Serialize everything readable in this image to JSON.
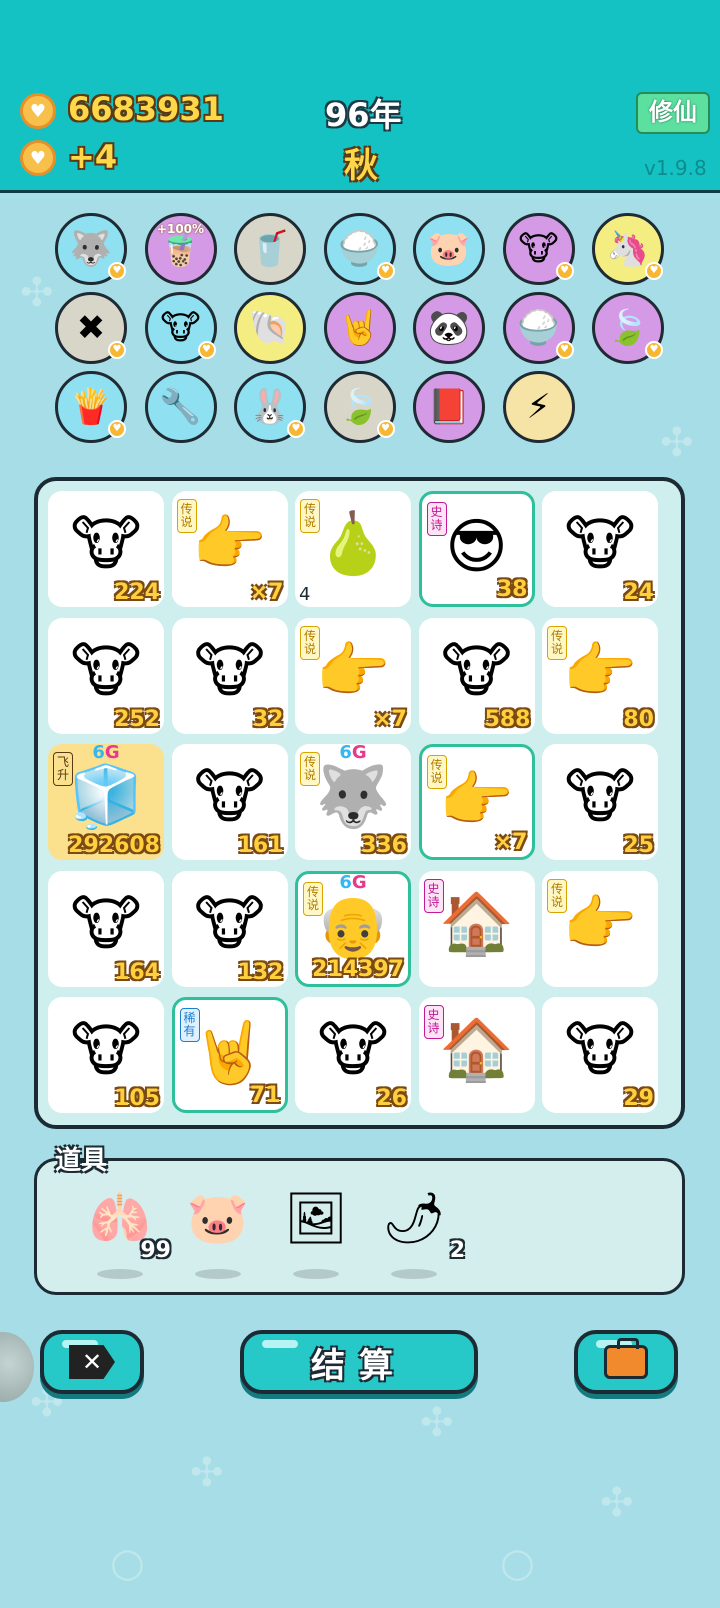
{
  "header": {
    "coins": "6683931",
    "income": "+4",
    "year": "96年",
    "season": "秋",
    "xiuxian_label": "修仙",
    "version": "v1.9.8"
  },
  "owned_icons": [
    {
      "name": "husky",
      "icon": "🐺",
      "bg": "#8fe0f0",
      "heart": true
    },
    {
      "name": "milk-tea-bonus",
      "icon": "🧋",
      "bg": "#d49ae6",
      "heart": false,
      "label": "+100%"
    },
    {
      "name": "bubble-tea",
      "icon": "🥤",
      "bg": "#d8d6c8",
      "heart": false
    },
    {
      "name": "rice-bowl",
      "icon": "🍚",
      "bg": "#8fe0f0",
      "heart": true
    },
    {
      "name": "piggy-bank",
      "icon": "🐷",
      "bg": "#8fe0f0",
      "heart": false
    },
    {
      "name": "cows-pair",
      "icon": "🐮",
      "bg": "#d49ae6",
      "heart": true
    },
    {
      "name": "unicorn",
      "icon": "🦄",
      "bg": "#f4ee82",
      "heart": true
    },
    {
      "name": "delete-tag",
      "icon": "✖",
      "bg": "#d8d6c8",
      "heart": true
    },
    {
      "name": "cows-pair-2",
      "icon": "🐮",
      "bg": "#8fe0f0",
      "heart": true
    },
    {
      "name": "shell",
      "icon": "🐚",
      "bg": "#f4ee82",
      "heart": false
    },
    {
      "name": "rock-hand",
      "icon": "🤘",
      "bg": "#d49ae6",
      "heart": false
    },
    {
      "name": "panda",
      "icon": "🐼",
      "bg": "#d49ae6",
      "heart": false
    },
    {
      "name": "rice-bowl-2",
      "icon": "🍚",
      "bg": "#d49ae6",
      "heart": true
    },
    {
      "name": "leaf",
      "icon": "🍃",
      "bg": "#d49ae6",
      "heart": true
    },
    {
      "name": "fries",
      "icon": "🍟",
      "bg": "#8fe0f0",
      "heart": true
    },
    {
      "name": "pump",
      "icon": "🔧",
      "bg": "#8fe0f0",
      "heart": false
    },
    {
      "name": "rabbit",
      "icon": "🐰",
      "bg": "#8fe0f0",
      "heart": true
    },
    {
      "name": "leaf-2",
      "icon": "🍃",
      "bg": "#d8d6c8",
      "heart": true
    },
    {
      "name": "time-magazine",
      "icon": "📕",
      "bg": "#d49ae6",
      "heart": false
    },
    {
      "name": "lightning",
      "icon": "⚡",
      "bg": "#f6e3a6",
      "heart": false
    }
  ],
  "board": [
    {
      "icon": "🐮",
      "count": "224"
    },
    {
      "icon": "👉",
      "count": "×7",
      "tag": "传说",
      "tag_type": "legend"
    },
    {
      "icon": "🍐",
      "count_left": "4",
      "tag": "传说",
      "tag_type": "legend"
    },
    {
      "icon": "😎",
      "count": "38",
      "tag": "史诗",
      "tag_type": "epic",
      "selected": true
    },
    {
      "icon": "🐮",
      "count": "24"
    },
    {
      "icon": "🐮",
      "count": "252"
    },
    {
      "icon": "🐮",
      "count": "32"
    },
    {
      "icon": "👉",
      "count": "×7",
      "tag": "传说",
      "tag_type": "legend"
    },
    {
      "icon": "🐮",
      "count": "588"
    },
    {
      "icon": "👉",
      "count": "80",
      "tag": "传说",
      "tag_type": "legend"
    },
    {
      "icon": "🧊",
      "count": "292608",
      "tag": "飞升",
      "tag_type": "fly",
      "gold": true,
      "sixg": true
    },
    {
      "icon": "🐮",
      "count": "161"
    },
    {
      "icon": "🐺",
      "count": "336",
      "tag": "传说",
      "tag_type": "legend",
      "sixg": true
    },
    {
      "icon": "👉",
      "count": "×7",
      "tag": "传说",
      "tag_type": "legend",
      "selected": true
    },
    {
      "icon": "🐮",
      "count": "25"
    },
    {
      "icon": "🐮",
      "count": "164"
    },
    {
      "icon": "🐮",
      "count": "132"
    },
    {
      "icon": "👴",
      "count": "214397",
      "tag": "传说",
      "tag_type": "legend",
      "selected": true,
      "sixg": true
    },
    {
      "icon": "🏠",
      "count": "",
      "tag": "史诗",
      "tag_type": "epic"
    },
    {
      "icon": "👉",
      "count": "",
      "tag": "传说",
      "tag_type": "legend"
    },
    {
      "icon": "🐮",
      "count": "105"
    },
    {
      "icon": "🤘",
      "count": "71",
      "tag": "稀有",
      "tag_type": "rare",
      "selected": true
    },
    {
      "icon": "🐮",
      "count": "26"
    },
    {
      "icon": "🏠",
      "count": "",
      "tag": "史诗",
      "tag_type": "epic"
    },
    {
      "icon": "🐮",
      "count": "29"
    }
  ],
  "sixg": {
    "six": "6",
    "g": "G"
  },
  "props": {
    "label": "道具",
    "items": [
      {
        "name": "liver",
        "icon": "🫁",
        "count": "99"
      },
      {
        "name": "piggy",
        "icon": "🐷",
        "count": ""
      },
      {
        "name": "panda-frame",
        "icon": "🖼",
        "count": ""
      },
      {
        "name": "chili",
        "icon": "🌶",
        "count": "2"
      }
    ]
  },
  "buttons": {
    "settle_label": "结算",
    "delete_symbol": "✕"
  }
}
